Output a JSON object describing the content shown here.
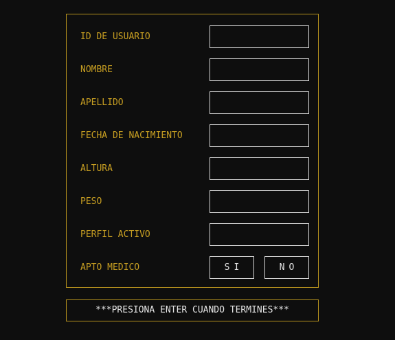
{
  "form": {
    "fields": [
      {
        "label": "ID DE USUARIO",
        "value": ""
      },
      {
        "label": "NOMBRE",
        "value": ""
      },
      {
        "label": "APELLIDO",
        "value": ""
      },
      {
        "label": "FECHA DE NACIMIENTO",
        "value": ""
      },
      {
        "label": "ALTURA",
        "value": ""
      },
      {
        "label": "PESO",
        "value": ""
      },
      {
        "label": "PERFIL ACTIVO",
        "value": ""
      }
    ],
    "apto_medico": {
      "label": "APTO MEDICO",
      "yes_label": "SI",
      "no_label": "NO"
    }
  },
  "footer": {
    "hint": "***PRESIONA ENTER CUANDO TERMINES***"
  },
  "colors": {
    "background": "#0e0e0e",
    "accent_border": "#b8941e",
    "label_text": "#c89f22",
    "input_border": "#d9d9d9",
    "hint_text": "#e6e6e6"
  }
}
